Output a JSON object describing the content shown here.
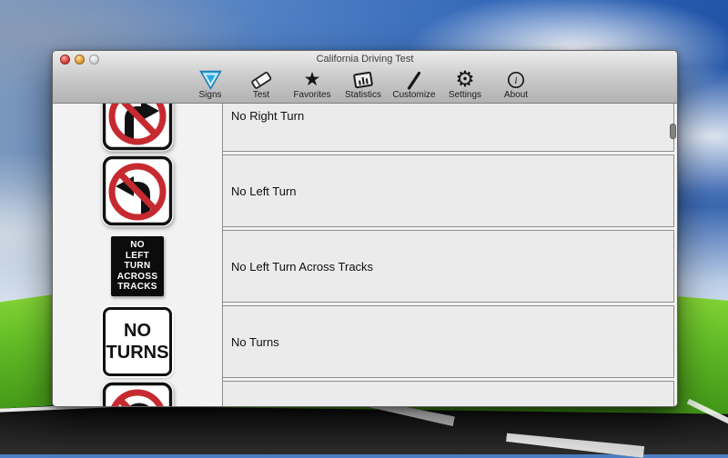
{
  "window": {
    "title": "California Driving Test"
  },
  "toolbar": {
    "items": [
      {
        "label": "Signs"
      },
      {
        "label": "Test"
      },
      {
        "label": "Favorites"
      },
      {
        "label": "Statistics"
      },
      {
        "label": "Customize"
      },
      {
        "label": "Settings"
      },
      {
        "label": "About"
      }
    ]
  },
  "icons": {
    "star": "★",
    "gear": "⚙",
    "info": "i"
  },
  "sign_list": {
    "rows": [
      {
        "label": "No Right Turn",
        "sign": "no-right-turn-sign"
      },
      {
        "label": "No Left Turn",
        "sign": "no-left-turn-sign"
      },
      {
        "label": "No Left Turn Across Tracks",
        "sign": "no-left-turn-across-tracks-sign",
        "sign_text": [
          "NO",
          "LEFT",
          "TURN",
          "ACROSS",
          "TRACKS"
        ]
      },
      {
        "label": "No Turns",
        "sign": "no-turns-sign",
        "sign_text": [
          "NO",
          "TURNS"
        ]
      },
      {
        "label": "",
        "sign": "no-u-turn-sign"
      }
    ]
  },
  "colors": {
    "accent_blue": "#2fa9e2",
    "sign_red": "#c62a30"
  }
}
